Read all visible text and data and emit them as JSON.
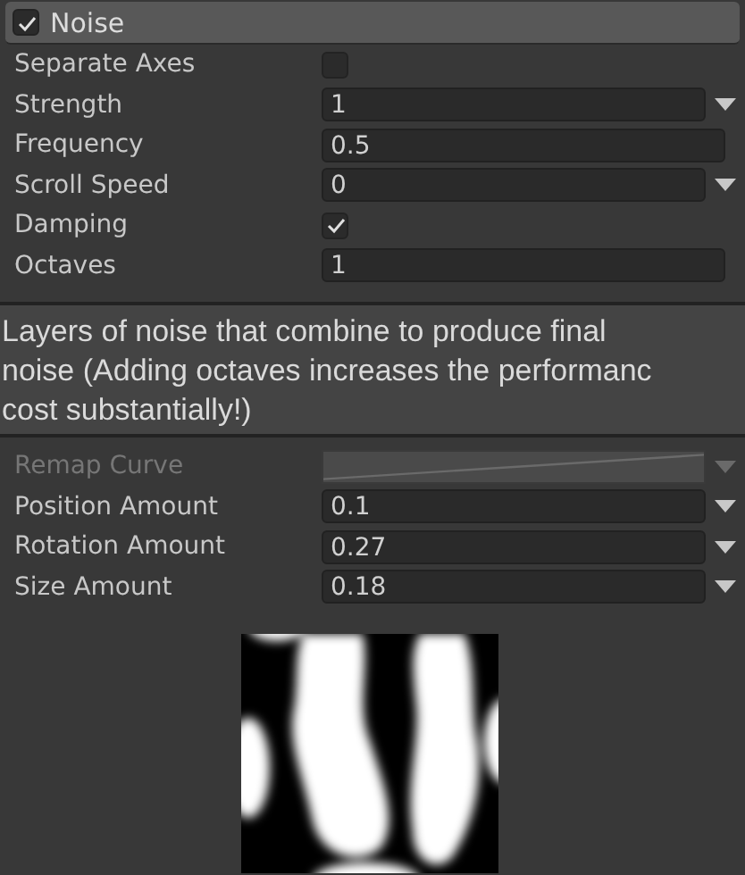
{
  "module": {
    "title": "Noise",
    "checked": true
  },
  "fields": [
    {
      "kind": "checkbox",
      "label": "Separate Axes",
      "checked": false
    },
    {
      "kind": "number",
      "label": "Strength",
      "value": "1",
      "dropdown": true
    },
    {
      "kind": "number",
      "label": "Frequency",
      "value": "0.5",
      "dropdown": false
    },
    {
      "kind": "number",
      "label": "Scroll Speed",
      "value": "0",
      "dropdown": true
    },
    {
      "kind": "checkbox",
      "label": "Damping",
      "checked": true
    },
    {
      "kind": "number",
      "label": "Octaves",
      "value": "1",
      "dropdown": false
    }
  ],
  "tooltip": {
    "lines": [
      "Layers of noise that combine to produce final",
      "noise (Adding octaves increases the performanc",
      "cost substantially!)"
    ]
  },
  "fields_below": [
    {
      "kind": "curve",
      "label": "Remap Curve",
      "disabled": true,
      "dropdown": true
    },
    {
      "kind": "number",
      "label": "Position Amount",
      "value": "0.1",
      "dropdown": true
    },
    {
      "kind": "number",
      "label": "Rotation Amount",
      "value": "0.27",
      "dropdown": true
    },
    {
      "kind": "number",
      "label": "Size Amount",
      "value": "0.18",
      "dropdown": true
    }
  ]
}
